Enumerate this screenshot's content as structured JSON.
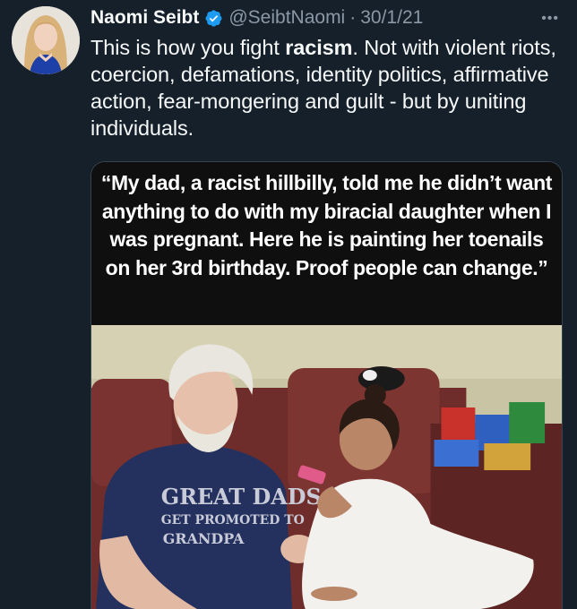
{
  "author": {
    "name": "Naomi Seibt",
    "handle": "@SeibtNaomi",
    "separator": "·",
    "date": "30/1/21"
  },
  "more_label": "•••",
  "tweet_text": {
    "before": "This is how you fight ",
    "bold": "racism",
    "after": ". Not with violent riots, coercion, defamations, identity politics, affirmative action, fear-mongering and guilt - but by uniting individuals."
  },
  "media": {
    "quote": "“My dad, a racist hillbilly, told me he didn’t want anything to do with my biracial daughter when I was pregnant. Here he is painting her toenails on her 3rd birthday. Proof people can change.”",
    "shirt_text_line1": "GREAT DADS",
    "shirt_text_line2": "GET PROMOTED TO",
    "shirt_text_line3": "GRANDPA"
  },
  "colors": {
    "background": "#15202b",
    "text_primary": "#f7f9f9",
    "text_secondary": "#8b98a5",
    "verified_badge": "#1d9bf0"
  },
  "icons": [
    "verified-badge-icon",
    "more-options-icon"
  ]
}
